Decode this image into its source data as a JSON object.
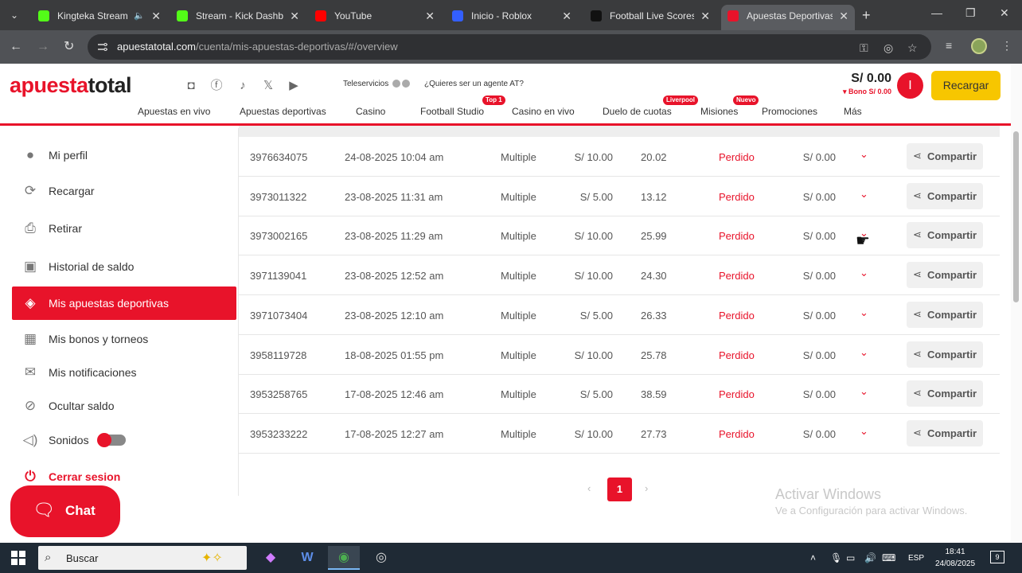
{
  "browser": {
    "tabs": [
      {
        "title": "Kingteka Stream",
        "favicon_color": "#53fc18",
        "audio": true
      },
      {
        "title": "Stream - Kick Dashbo",
        "favicon_color": "#53fc18"
      },
      {
        "title": "YouTube",
        "favicon_color": "#ff0000"
      },
      {
        "title": "Inicio - Roblox",
        "favicon_color": "#335fff"
      },
      {
        "title": "Football Live Scores,",
        "favicon_color": "#111111"
      },
      {
        "title": "Apuestas Deportivas",
        "favicon_color": "#e8132a",
        "active": true
      }
    ],
    "url_domain": "apuestatotal.com",
    "url_path": "/cuenta/mis-apuestas-deportivas/#/overview"
  },
  "site": {
    "logo_a": "apuesta",
    "logo_b": "total",
    "teleservicios": "Teleservicios",
    "agent_link": "¿Quieres ser un agente AT?",
    "balance": "S/ 0.00",
    "bono": "▾ Bono S/ 0.00",
    "avatar_letter": "I",
    "recargar": "Recargar",
    "nav": [
      {
        "label": "Apuestas en vivo"
      },
      {
        "label": "Apuestas deportivas"
      },
      {
        "label": "Casino"
      },
      {
        "label": "Football Studio",
        "badge": "Top 1"
      },
      {
        "label": "Casino en vivo"
      },
      {
        "label": "Duelo de cuotas",
        "badge": "Liverpool"
      },
      {
        "label": "Misiones",
        "badge": "Nuevo"
      },
      {
        "label": "Promociones"
      },
      {
        "label": "Más"
      }
    ]
  },
  "sidebar": {
    "items": [
      {
        "label": "Mi perfil",
        "icon": "user-icon"
      },
      {
        "label": "Recargar",
        "icon": "recharge-icon"
      },
      {
        "label": "Retirar",
        "icon": "withdraw-icon"
      },
      {
        "label": "Historial de saldo",
        "icon": "wallet-icon"
      },
      {
        "label": "Mis apuestas deportivas",
        "icon": "ticket-icon",
        "active": true
      },
      {
        "label": "Mis bonos y torneos",
        "icon": "gift-icon"
      },
      {
        "label": "Mis notificaciones",
        "icon": "mail-icon"
      },
      {
        "label": "Ocultar saldo",
        "icon": "eye-off-icon"
      },
      {
        "label": "Sonidos",
        "icon": "speaker-icon",
        "toggle": true
      },
      {
        "label": "Cerrar sesion",
        "icon": "power-icon"
      }
    ],
    "chat": "Chat"
  },
  "bets": {
    "rows": [
      {
        "id": "3976634075",
        "date": "24-08-2025 10:04 am",
        "type": "Multiple",
        "stake": "S/ 10.00",
        "odds": "20.02",
        "result": "Perdido",
        "gain": "S/ 0.00"
      },
      {
        "id": "3973011322",
        "date": "23-08-2025 11:31 am",
        "type": "Multiple",
        "stake": "S/ 5.00",
        "odds": "13.12",
        "result": "Perdido",
        "gain": "S/ 0.00"
      },
      {
        "id": "3973002165",
        "date": "23-08-2025 11:29 am",
        "type": "Multiple",
        "stake": "S/ 10.00",
        "odds": "25.99",
        "result": "Perdido",
        "gain": "S/ 0.00"
      },
      {
        "id": "3971139041",
        "date": "23-08-2025 12:52 am",
        "type": "Multiple",
        "stake": "S/ 10.00",
        "odds": "24.30",
        "result": "Perdido",
        "gain": "S/ 0.00"
      },
      {
        "id": "3971073404",
        "date": "23-08-2025 12:10 am",
        "type": "Multiple",
        "stake": "S/ 5.00",
        "odds": "26.33",
        "result": "Perdido",
        "gain": "S/ 0.00"
      },
      {
        "id": "3958119728",
        "date": "18-08-2025 01:55 pm",
        "type": "Multiple",
        "stake": "S/ 10.00",
        "odds": "25.78",
        "result": "Perdido",
        "gain": "S/ 0.00"
      },
      {
        "id": "3953258765",
        "date": "17-08-2025 12:46 am",
        "type": "Multiple",
        "stake": "S/ 5.00",
        "odds": "38.59",
        "result": "Perdido",
        "gain": "S/ 0.00"
      },
      {
        "id": "3953233222",
        "date": "17-08-2025 12:27 am",
        "type": "Multiple",
        "stake": "S/ 10.00",
        "odds": "27.73",
        "result": "Perdido",
        "gain": "S/ 0.00"
      }
    ],
    "share_label": "Compartir",
    "page": "1"
  },
  "watermark": {
    "line1": "Activar Windows",
    "line2": "Ve a Configuración para activar Windows."
  },
  "taskbar": {
    "search": "Buscar",
    "lang": "ESP",
    "time": "18:41",
    "date": "24/08/2025",
    "notifications": "9"
  },
  "colors": {
    "brand": "#e8132a",
    "accent": "#f7c600"
  }
}
